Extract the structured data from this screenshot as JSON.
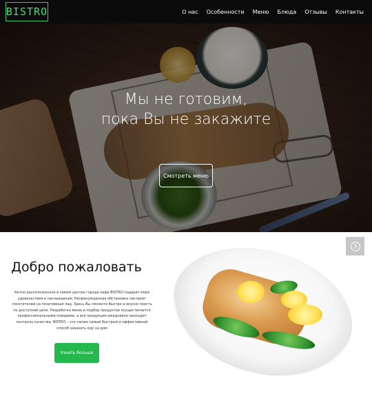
{
  "header": {
    "logo_text": "BISTRO",
    "logo_color": "#33cc66",
    "nav": [
      {
        "label": "О нас"
      },
      {
        "label": "Особенности"
      },
      {
        "label": "Меню"
      },
      {
        "label": "Блюда"
      },
      {
        "label": "Отзывы"
      },
      {
        "label": "Контакты"
      }
    ]
  },
  "hero": {
    "title_line1": "Мы не готовим,",
    "title_line2": "пока Вы не закажите",
    "button_label": "Смотреть меню"
  },
  "welcome": {
    "title": "Добро пожаловать",
    "text": "Уютно расположенное в самом центре города кафе BISTRO подарит море удовольствия и наслаждения. Непринужденная обстановка настроит посетителей на позитивный лад. Здесь Вы сможете быстро и вкусно поесть по доступной цене. Разработка меню и подбор продуктов осуществляется профессиональными поварами, а вся продукция ежедневно проходит контроль качества. BISTRO – это также самый быстрый и эффективный способ заказать еду на дом",
    "button_label": "Узнать больше",
    "button_color": "#25b84f"
  },
  "icons": {
    "scroll_top": "chevron-up-circle-icon"
  }
}
